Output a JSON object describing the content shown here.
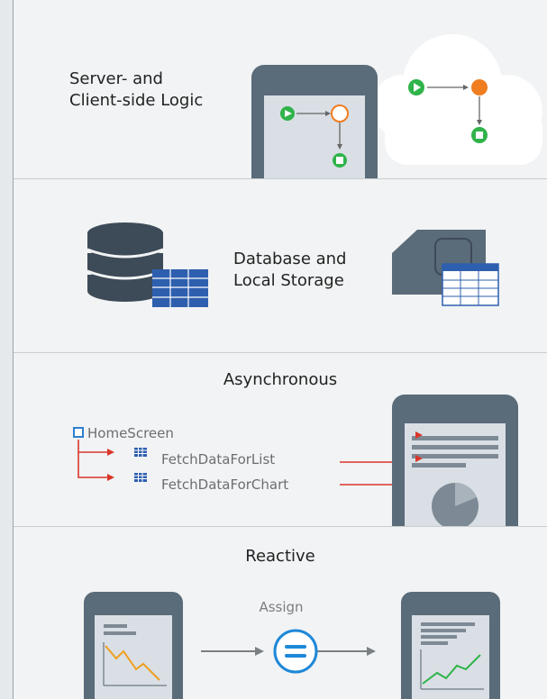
{
  "sections": {
    "logic": {
      "title_line1": "Server- and",
      "title_line2": "Client-side Logic"
    },
    "database": {
      "title_line1": "Database and",
      "title_line2": "Local Storage"
    },
    "async": {
      "title": "Asynchronous",
      "tree": {
        "root": "HomeScreen",
        "children": [
          "FetchDataForList",
          "FetchDataForChart"
        ]
      }
    },
    "reactive": {
      "title": "Reactive",
      "assign_label": "Assign"
    }
  },
  "colors": {
    "phone_frame": "#5a6b7a",
    "phone_screen": "#d9dfe4",
    "start_green": "#2fb34a",
    "node_orange": "#f07d1f",
    "arrow_red": "#d9362b",
    "table_blue": "#2e5fae",
    "assign_blue": "#1e88d8"
  }
}
